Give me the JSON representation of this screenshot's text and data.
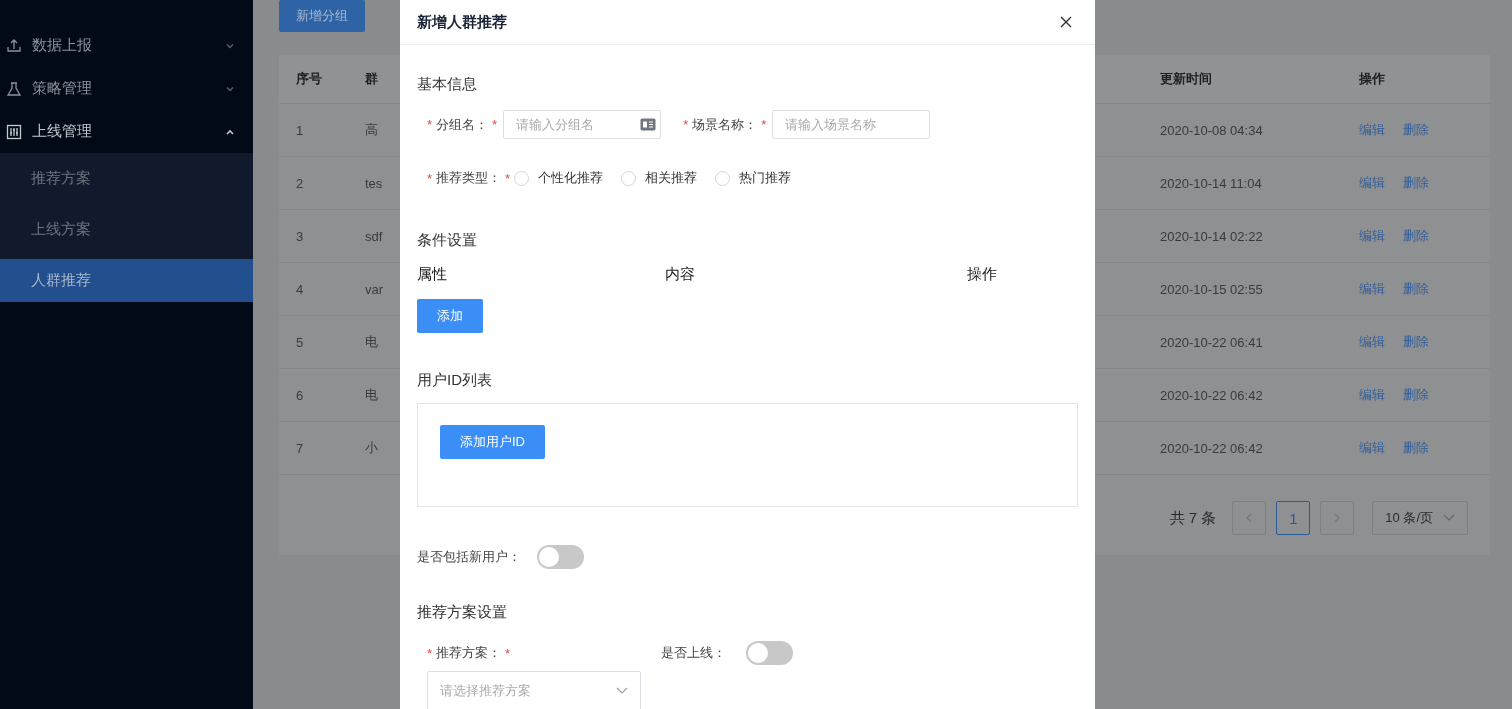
{
  "sidebar": {
    "items": [
      {
        "label": "数据上报",
        "expanded": false
      },
      {
        "label": "策略管理",
        "expanded": false
      },
      {
        "label": "上线管理",
        "expanded": true,
        "children": [
          {
            "label": "推荐方案",
            "selected": false
          },
          {
            "label": "上线方案",
            "selected": false
          },
          {
            "label": "人群推荐",
            "selected": true
          }
        ]
      }
    ]
  },
  "toolbar": {
    "add_button": "新增分组"
  },
  "table": {
    "columns": [
      "序号",
      "群",
      "更新时间",
      "操作"
    ],
    "rows": [
      {
        "no": "1",
        "name": "高",
        "updated": "2020-10-08 04:34",
        "actions": [
          "编辑",
          "删除"
        ]
      },
      {
        "no": "2",
        "name": "tes",
        "updated": "2020-10-14 11:04",
        "actions": [
          "编辑",
          "删除"
        ]
      },
      {
        "no": "3",
        "name": "sdf",
        "updated": "2020-10-14 02:22",
        "actions": [
          "编辑",
          "删除"
        ]
      },
      {
        "no": "4",
        "name": "var",
        "updated": "2020-10-15 02:55",
        "actions": [
          "编辑",
          "删除"
        ]
      },
      {
        "no": "5",
        "name": "电",
        "updated": "2020-10-22 06:41",
        "actions": [
          "编辑",
          "删除"
        ]
      },
      {
        "no": "6",
        "name": "电",
        "updated": "2020-10-22 06:42",
        "actions": [
          "编辑",
          "删除"
        ]
      },
      {
        "no": "7",
        "name": "小",
        "updated": "2020-10-22 06:42",
        "actions": [
          "编辑",
          "删除"
        ]
      }
    ]
  },
  "pagination": {
    "total": "共 7 条",
    "pages": [
      {
        "label": "1",
        "selected": true
      }
    ],
    "page_size": "10 条/页"
  },
  "dialog": {
    "title": "新增人群推荐",
    "required_mark": "*",
    "basic_info": {
      "title": "基本信息",
      "group_name": {
        "label": "分组名：",
        "required": true,
        "placeholder": "请输入分组名"
      },
      "scene_name": {
        "label": "场景名称：",
        "required": true,
        "placeholder": "请输入场景名称"
      },
      "recommend_type": {
        "label": "推荐类型：",
        "required": true,
        "options": [
          {
            "label": "个性化推荐",
            "selected": false
          },
          {
            "label": "相关推荐",
            "selected": false
          },
          {
            "label": "热门推荐",
            "selected": false
          }
        ]
      }
    },
    "conditions": {
      "title": "条件设置",
      "columns": [
        "属性",
        "内容",
        "操作"
      ],
      "add_button": "添加"
    },
    "user_ids": {
      "title": "用户ID列表",
      "add_button": "添加用户ID"
    },
    "include_new_users": {
      "label": "是否包括新用户：",
      "on": false
    },
    "plan_settings": {
      "title": "推荐方案设置",
      "plan": {
        "label": "推荐方案：",
        "required": true,
        "placeholder": "请选择推荐方案"
      },
      "online": {
        "label": "是否上线：",
        "on": false
      }
    }
  }
}
